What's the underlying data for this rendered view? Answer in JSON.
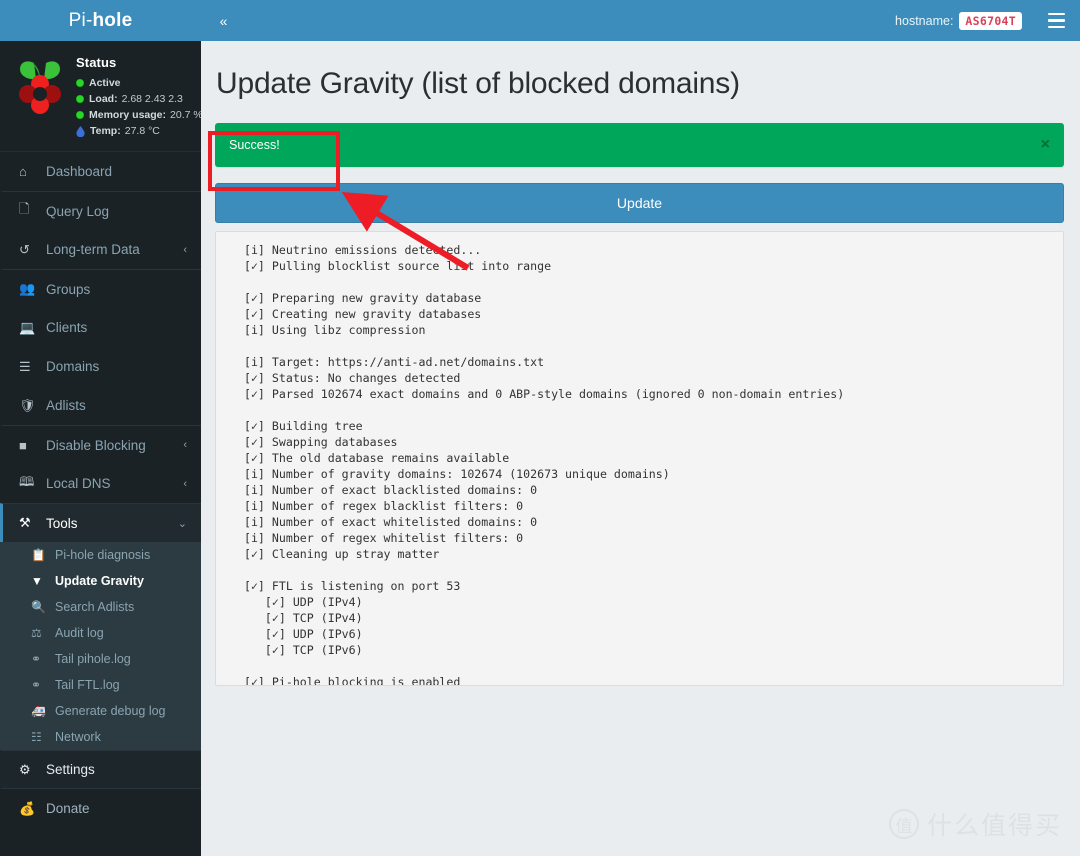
{
  "brand": {
    "name_prefix": "Pi-",
    "name_suffix": "hole"
  },
  "status": {
    "title": "Status",
    "lines": [
      {
        "icon": "green-dot",
        "label": "Active",
        "value": ""
      },
      {
        "icon": "green-dot",
        "label": "Load:",
        "value": "2.68  2.43  2.3"
      },
      {
        "icon": "green-dot",
        "label": "Memory usage:",
        "value": "20.7 %"
      },
      {
        "icon": "blue-droplet",
        "label": "Temp:",
        "value": "27.8 °C"
      }
    ]
  },
  "sidebar": {
    "items": [
      {
        "icon": "home-icon",
        "label": "Dashboard",
        "caret": "",
        "name": "dashboard"
      },
      {
        "icon": "file-icon",
        "label": "Query Log",
        "caret": "",
        "name": "query-log"
      },
      {
        "icon": "history-icon",
        "label": "Long-term Data",
        "caret": "‹",
        "name": "long-term-data"
      },
      {
        "icon": "users-icon",
        "label": "Groups",
        "caret": "",
        "name": "groups"
      },
      {
        "icon": "laptop-icon",
        "label": "Clients",
        "caret": "",
        "name": "clients"
      },
      {
        "icon": "list-icon",
        "label": "Domains",
        "caret": "",
        "name": "domains"
      },
      {
        "icon": "shield-icon",
        "label": "Adlists",
        "caret": "",
        "name": "adlists"
      },
      {
        "icon": "stop-icon",
        "label": "Disable Blocking",
        "caret": "‹",
        "name": "disable-blocking"
      },
      {
        "icon": "address-book-icon",
        "label": "Local DNS",
        "caret": "‹",
        "name": "local-dns"
      },
      {
        "icon": "tools-icon",
        "label": "Tools",
        "caret": "⌄",
        "name": "tools",
        "active": true
      }
    ],
    "tools_submenu": [
      {
        "icon": "diagnosis-icon",
        "label": "Pi-hole diagnosis",
        "name": "pihole-diagnosis"
      },
      {
        "icon": "download-circle-icon",
        "label": "Update Gravity",
        "name": "update-gravity",
        "active": true
      },
      {
        "icon": "search-icon",
        "label": "Search Adlists",
        "name": "search-adlists"
      },
      {
        "icon": "balance-scale-icon",
        "label": "Audit log",
        "name": "audit-log"
      },
      {
        "icon": "key-icon",
        "label": "Tail pihole.log",
        "name": "tail-pihole-log"
      },
      {
        "icon": "key-icon",
        "label": "Tail FTL.log",
        "name": "tail-ftl-log"
      },
      {
        "icon": "ambulance-icon",
        "label": "Generate debug log",
        "name": "generate-debug-log"
      },
      {
        "icon": "sitemap-icon",
        "label": "Network",
        "name": "network"
      }
    ],
    "settings": {
      "icon": "gear-icon",
      "label": "Settings",
      "name": "settings"
    },
    "donate": {
      "icon": "donate-icon",
      "label": "Donate",
      "name": "donate"
    }
  },
  "header": {
    "collapse_icon": "«",
    "hostname_label": "hostname:",
    "hostname_value": "AS6704T",
    "menu_icon": "hamburger-icon"
  },
  "main": {
    "page_title": "Update Gravity (list of blocked domains)",
    "alert": {
      "text": "Success!",
      "close_icon": "×",
      "color": "#00a65a"
    },
    "update_button": "Update",
    "terminal_output": "  [i] Neutrino emissions detected...\n  [✓] Pulling blocklist source list into range\n\n  [✓] Preparing new gravity database\n  [✓] Creating new gravity databases\n  [i] Using libz compression\n\n  [i] Target: https://anti-ad.net/domains.txt\n  [✓] Status: No changes detected\n  [✓] Parsed 102674 exact domains and 0 ABP-style domains (ignored 0 non-domain entries)\n\n  [✓] Building tree\n  [✓] Swapping databases\n  [✓] The old database remains available\n  [i] Number of gravity domains: 102674 (102673 unique domains)\n  [i] Number of exact blacklisted domains: 0\n  [i] Number of regex blacklist filters: 0\n  [i] Number of exact whitelisted domains: 0\n  [i] Number of regex whitelist filters: 0\n  [✓] Cleaning up stray matter\n\n  [✓] FTL is listening on port 53\n     [✓] UDP (IPv4)\n     [✓] TCP (IPv4)\n     [✓] UDP (IPv6)\n     [✓] TCP (IPv6)\n\n  [✓] Pi-hole blocking is enabled"
  },
  "annotations": {
    "highlight_color": "#ee1c25",
    "box_target": "success-alert",
    "arrow_points_to": "success-alert"
  },
  "watermark": {
    "logo_char": "值",
    "text": "什么值得买"
  },
  "colors": {
    "brand_blue": "#3c8dbc",
    "sidebar_dark": "#1a2226",
    "content_bg": "#e9edf0",
    "success_green": "#00a65a",
    "status_green": "#27d927",
    "annotation_red": "#ee1c25"
  }
}
